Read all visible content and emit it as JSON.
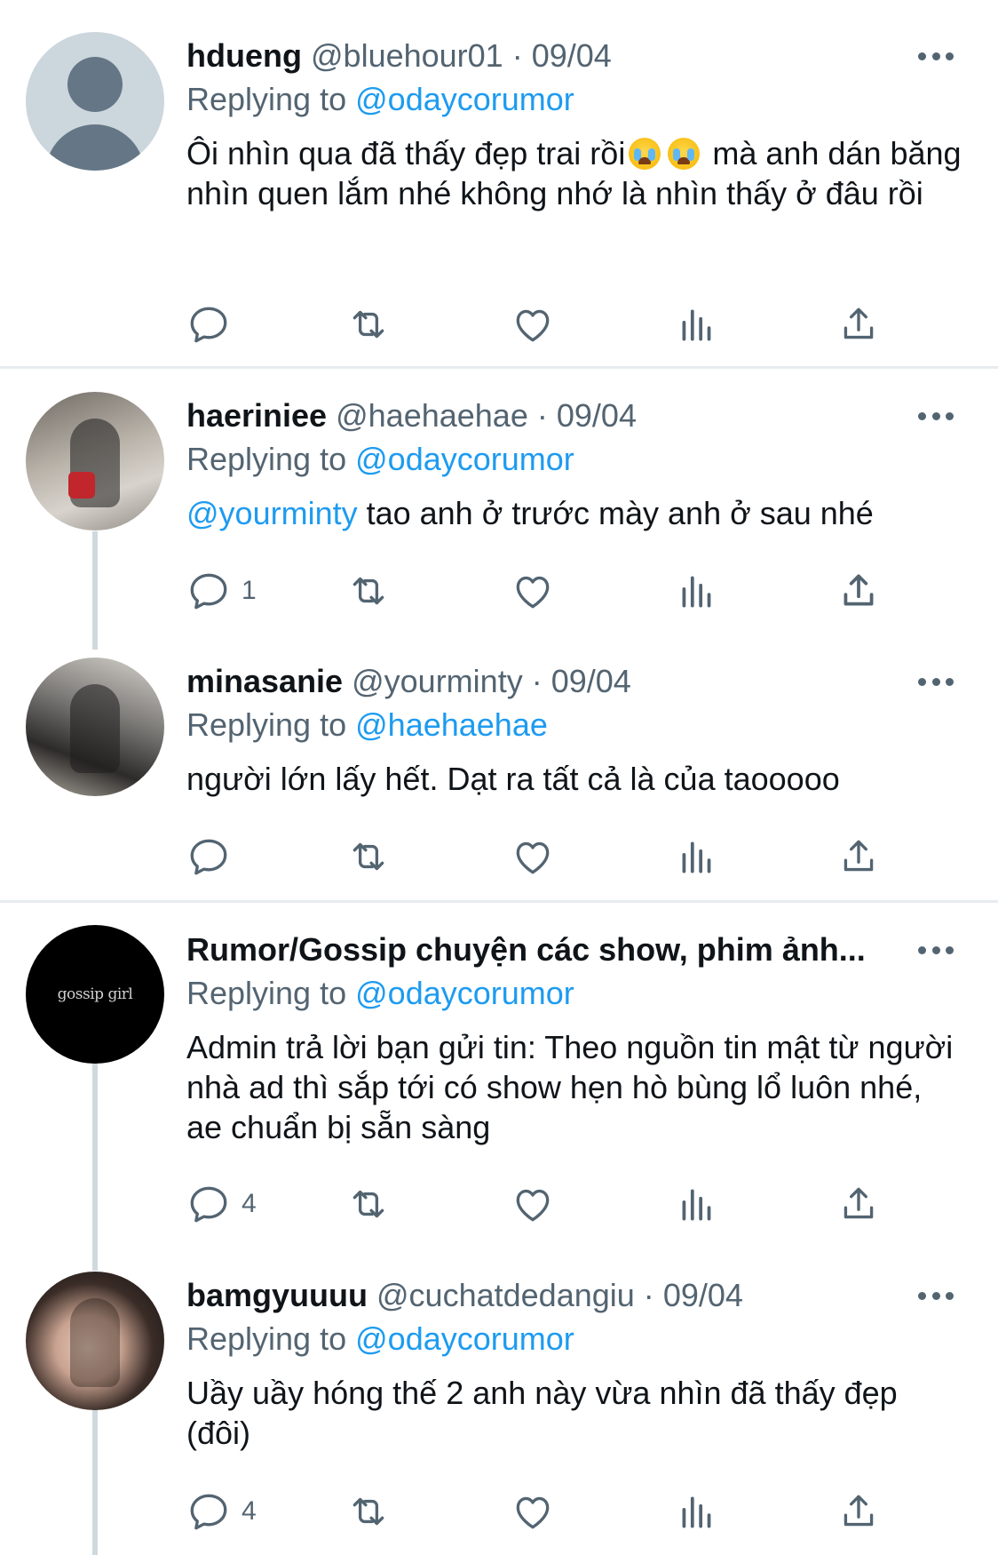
{
  "colors": {
    "link": "#1d9bf0",
    "secondary_text": "#536471",
    "primary_text": "#0f1419",
    "divider": "#e6ecf0"
  },
  "tweets": [
    {
      "name": "hdueng",
      "handle": "@bluehour01",
      "separator": "·",
      "date": "09/04",
      "replying_prefix": "Replying to",
      "replying_to": "@odaycorumor",
      "text_part1": "Ôi nhìn qua đã thấy đẹp trai rồi",
      "emoji": "loudly-crying-face",
      "text_part2": " mà anh dán băng nhìn quen lắm nhé không nhớ là nhìn thấy ở đâu rồi",
      "reply_count": "",
      "avatar": "default-avatar"
    },
    {
      "name": "haeriniee",
      "handle": "@haehaehae",
      "separator": "·",
      "date": "09/04",
      "replying_prefix": "Replying to",
      "replying_to": "@odaycorumor",
      "text_mention": "@yourminty",
      "text": " tao anh ở trước mày anh ở sau nhé",
      "reply_count": "1",
      "avatar": "photo-avatar"
    },
    {
      "name": "minasanie",
      "handle": "@yourminty",
      "separator": "·",
      "date": "09/04",
      "replying_prefix": "Replying to",
      "replying_to": "@haehaehae",
      "text": "người lớn lấy hết. Dạt ra tất cả là của taooooo",
      "reply_count": "",
      "avatar": "photo-avatar"
    },
    {
      "name": "Rumor/Gossip chuyện các show, phim ảnh...",
      "replying_prefix": "Replying to",
      "replying_to": "@odaycorumor",
      "text": "Admin trả lời bạn gửi tin: Theo nguồn tin mật từ người nhà ad thì sắp tới có show hẹn hò bùng lổ luôn nhé, ae chuẩn bị sẵn sàng",
      "reply_count": "4",
      "avatar_text": "gossip girl"
    },
    {
      "name": "bamgyuuuu",
      "handle": "@cuchatdedangiu",
      "separator": "·",
      "date": "09/04",
      "replying_prefix": "Replying to",
      "replying_to": "@odaycorumor",
      "text": "Uầy uầy hóng thế 2 anh này vừa nhìn đã thấy đẹp (đôi)",
      "reply_count": "4",
      "avatar": "photo-avatar"
    }
  ],
  "action_icons": [
    "reply-icon",
    "retweet-icon",
    "like-icon",
    "views-icon",
    "share-icon"
  ]
}
